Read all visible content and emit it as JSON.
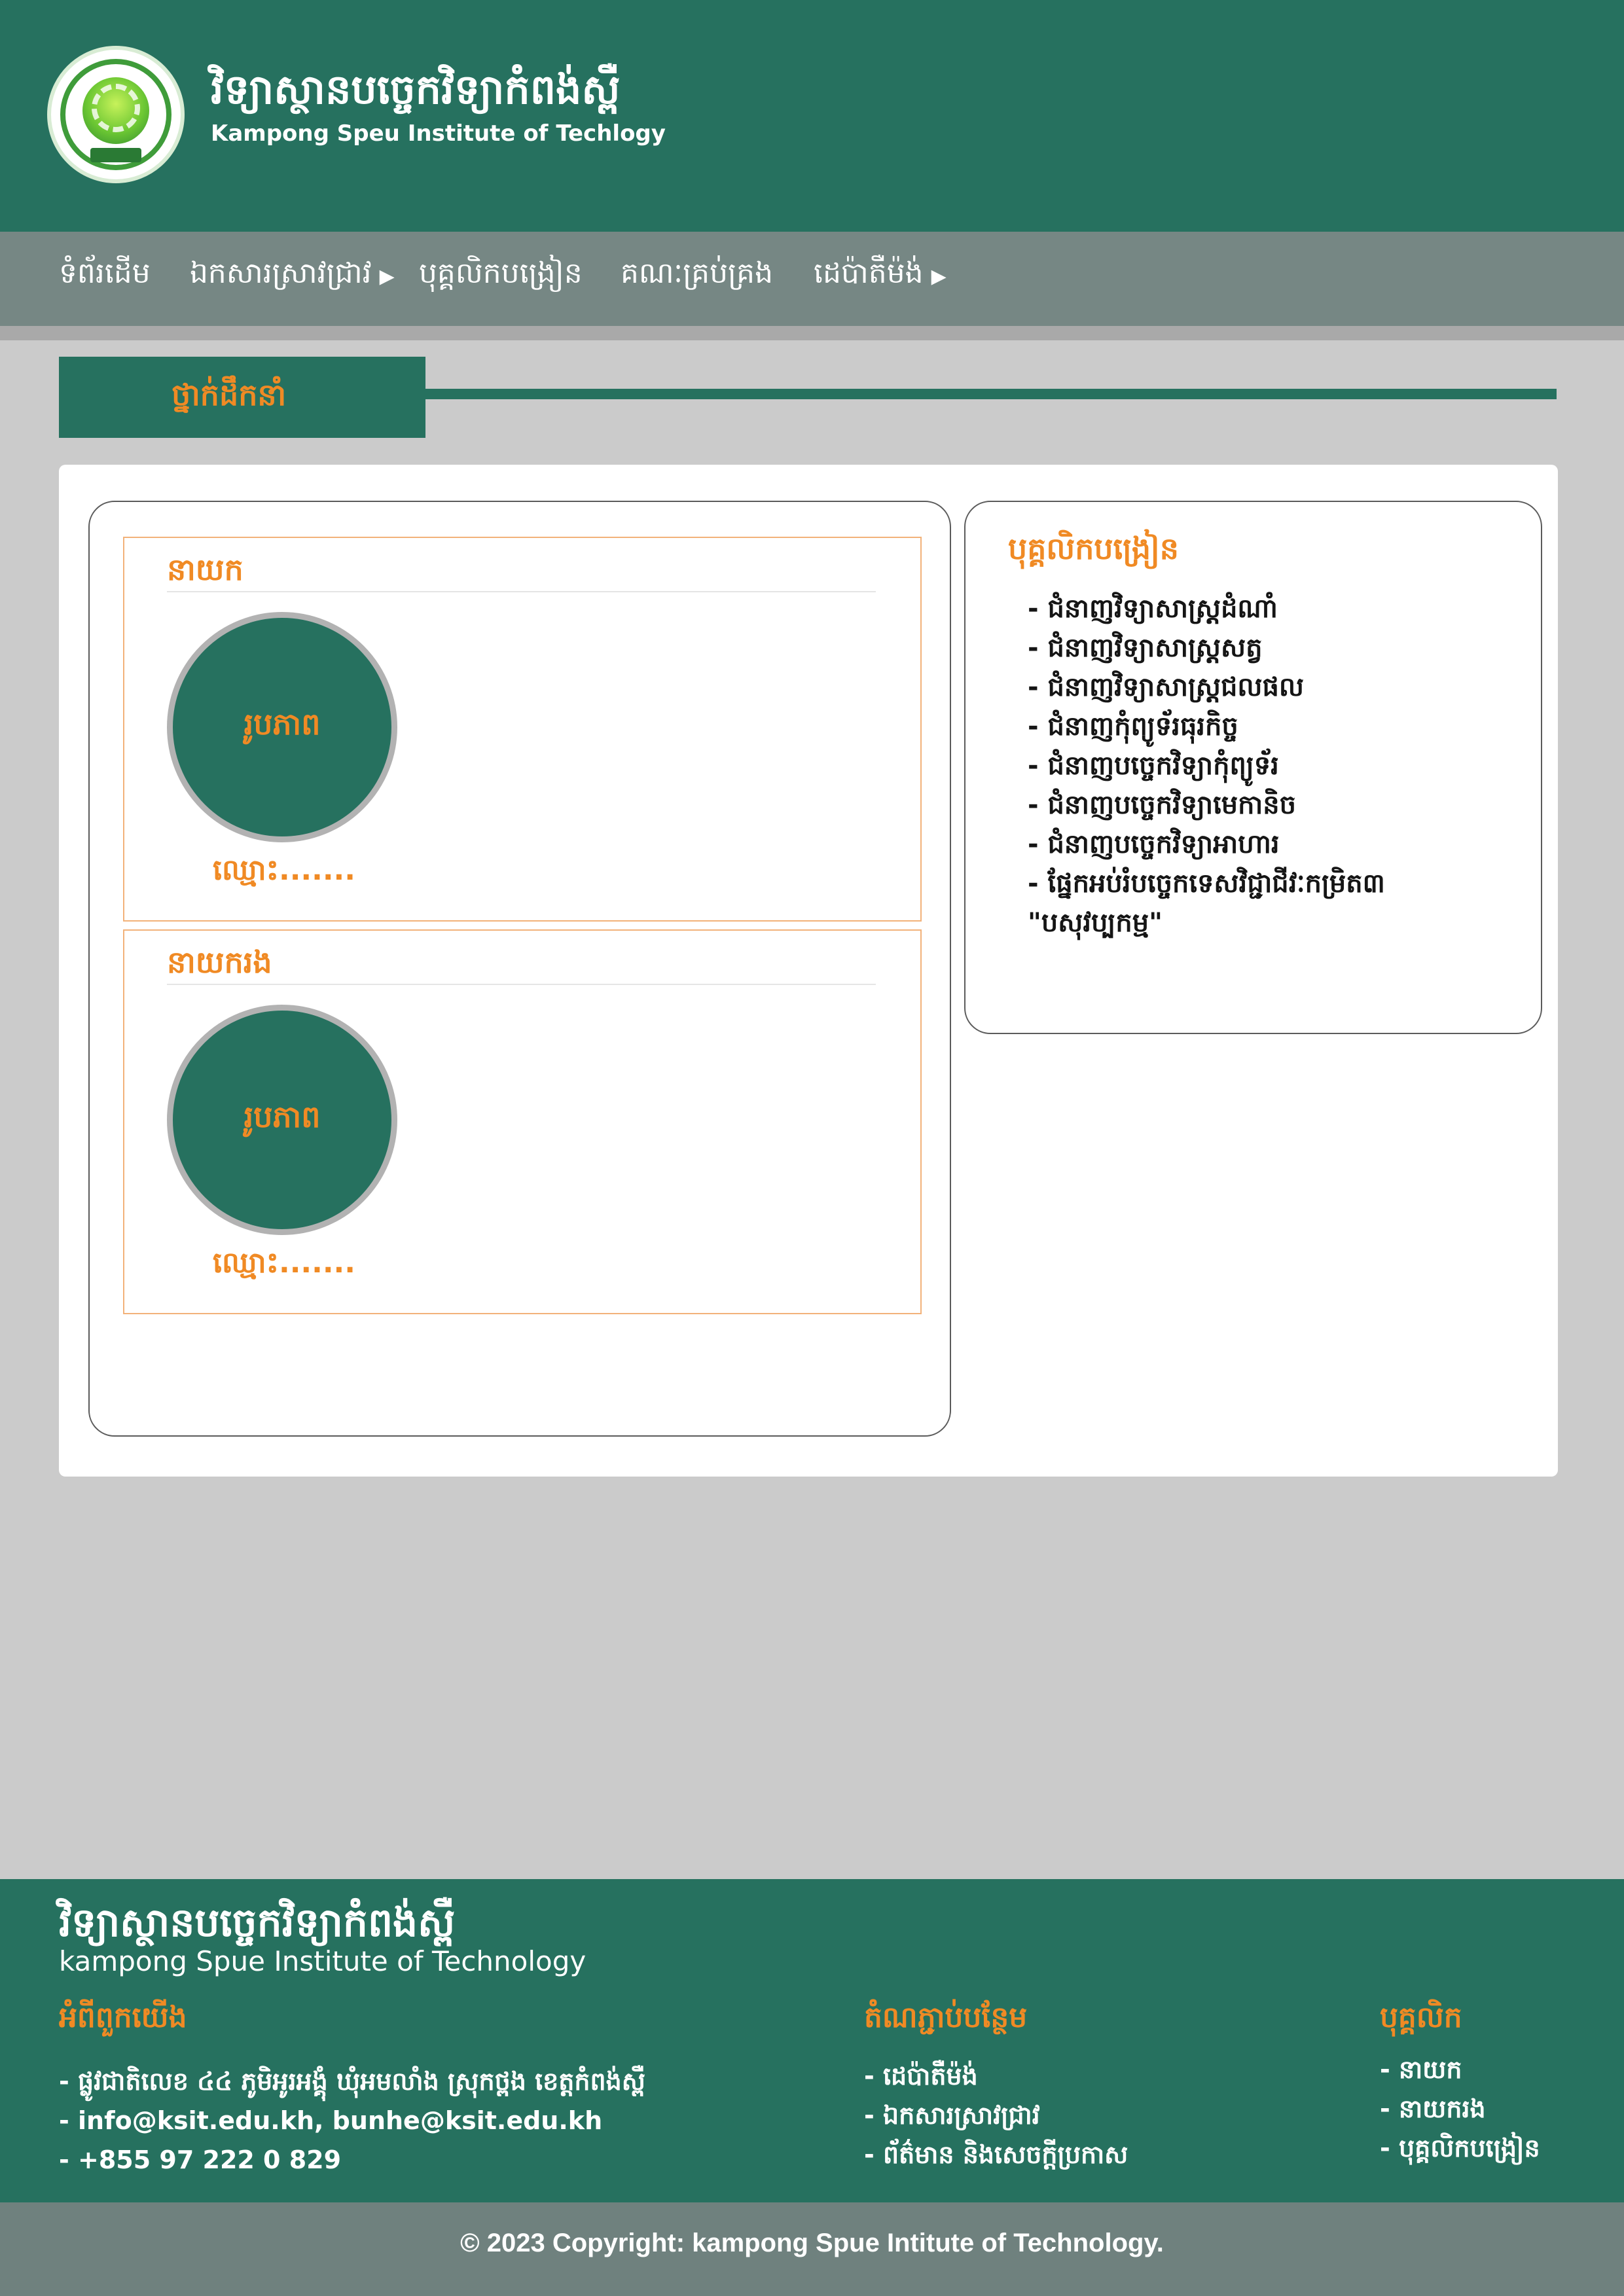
{
  "header": {
    "title_kh": "វិទ្យាស្ថានបច្ចេកវិទ្យាកំពង់ស្ពឺ",
    "title_en": "Kampong Speu Institute of Techlogy"
  },
  "nav": {
    "items": [
      {
        "label": "ទំព័រដើម"
      },
      {
        "label": "ឯកសារស្រាវជ្រាវ",
        "arrow": "▶"
      },
      {
        "label": "បុគ្គលិកបង្រៀន"
      },
      {
        "label": "គណៈគ្រប់គ្រង"
      },
      {
        "label": "ដេប៉ាតឺម៉ង់",
        "arrow": "▶"
      }
    ]
  },
  "section": {
    "title": "ថ្នាក់ដឹកនាំ"
  },
  "leaders": [
    {
      "role": "នាយក",
      "photo_label": "រូបភាព",
      "name": "ឈ្មោះ......."
    },
    {
      "role": "នាយករង",
      "photo_label": "រូបភាព",
      "name": "ឈ្មោះ......."
    }
  ],
  "staff": {
    "title": "បុគ្គលិកបង្រៀន",
    "items": [
      "- ជំនាញវិទ្យាសាស្រ្តដំណាំ",
      "- ជំនាញវិទ្យាសាស្រ្តសត្វ",
      "- ជំនាញវិទ្យាសាស្រ្តជលផល",
      "- ជំនាញកុំព្យូទ័រធុរកិច្ច",
      "- ជំនាញបច្ចេកវិទ្យាកុំព្យូទ័រ",
      "- ជំនាញបច្ចេកវិទ្យាមេកានិច",
      "- ជំនាញបច្ចេកវិទ្យាអាហារ",
      "-  ផ្នែកអប់រំបច្ចេកទេសវិជ្ជាជីវៈកម្រិត៣",
      "\"បសុវប្បកម្ម\""
    ]
  },
  "footer": {
    "title_kh": "វិទ្យាស្ថានបច្ចេកវិទ្យាកំពង់ស្ពឺ",
    "title_en": "kampong Spue Institute of Technology",
    "about": {
      "heading": "អំពីពួកយើង",
      "lines": [
        "- ផ្លូវជាតិលេខ ៤៤ ភូមិអូរអង្គុំ ឃុំអមលាំង ស្រុកថ្ពង ខេត្តកំពង់ស្ពឺ",
        "- info@ksit.edu.kh, bunhe@ksit.edu.kh",
        "- +855 97 222 0 829"
      ]
    },
    "links": {
      "heading": "តំណភ្ជាប់បន្ថែម",
      "items": [
        "- ដេប៉ាតឺម៉ង់",
        "- ឯកសារស្រាវជ្រាវ",
        "- ព័ត៌មាន និងសេចក្ដីប្រកាស"
      ]
    },
    "staff": {
      "heading": "បុគ្គលិក",
      "items": [
        "- នាយក",
        "- នាយករង",
        "- បុគ្គលិកបង្រៀន"
      ]
    },
    "copyright": "© 2023 Copyright: kampong Spue Intitute of Technology."
  },
  "colors": {
    "primary": "#26715f",
    "accent": "#f08a24",
    "nav": "#768784",
    "background": "#cbcbcb"
  }
}
